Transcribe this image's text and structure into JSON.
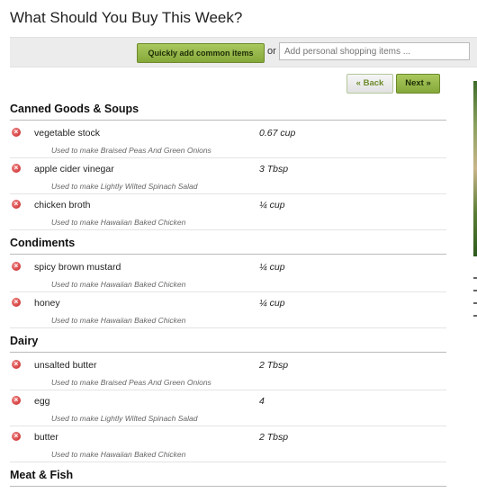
{
  "header": {
    "title": "What Should You Buy This Week?"
  },
  "addbar": {
    "quick_label": "Quickly add common items",
    "or_label": "or",
    "input_placeholder": "Add personal shopping items ..."
  },
  "nav": {
    "back_label": "« Back",
    "next_label": "Next »"
  },
  "categories": [
    {
      "name": "Canned Goods & Soups",
      "items": [
        {
          "name": "vegetable stock",
          "qty": "0.67 cup",
          "note": "Used to make Braised Peas And Green Onions"
        },
        {
          "name": "apple cider vinegar",
          "qty": "3 Tbsp",
          "note": "Used to make Lightly Wilted Spinach Salad"
        },
        {
          "name": "chicken broth",
          "qty": "¼ cup",
          "note": "Used to make Hawaiian Baked Chicken"
        }
      ]
    },
    {
      "name": "Condiments",
      "items": [
        {
          "name": "spicy brown mustard",
          "qty": "¼ cup",
          "note": "Used to make Hawaiian Baked Chicken"
        },
        {
          "name": "honey",
          "qty": "¼ cup",
          "note": "Used to make Hawaiian Baked Chicken"
        }
      ]
    },
    {
      "name": "Dairy",
      "items": [
        {
          "name": "unsalted butter",
          "qty": "2 Tbsp",
          "note": "Used to make Braised Peas And Green Onions"
        },
        {
          "name": "egg",
          "qty": "4",
          "note": "Used to make Lightly Wilted Spinach Salad"
        },
        {
          "name": "butter",
          "qty": "2 Tbsp",
          "note": "Used to make Hawaiian Baked Chicken"
        }
      ]
    },
    {
      "name": "Meat & Fish",
      "items": []
    }
  ],
  "icons": {
    "remove": "remove-x-icon"
  },
  "colors": {
    "accent": "#8bad3f",
    "remove": "#d42a2a"
  }
}
